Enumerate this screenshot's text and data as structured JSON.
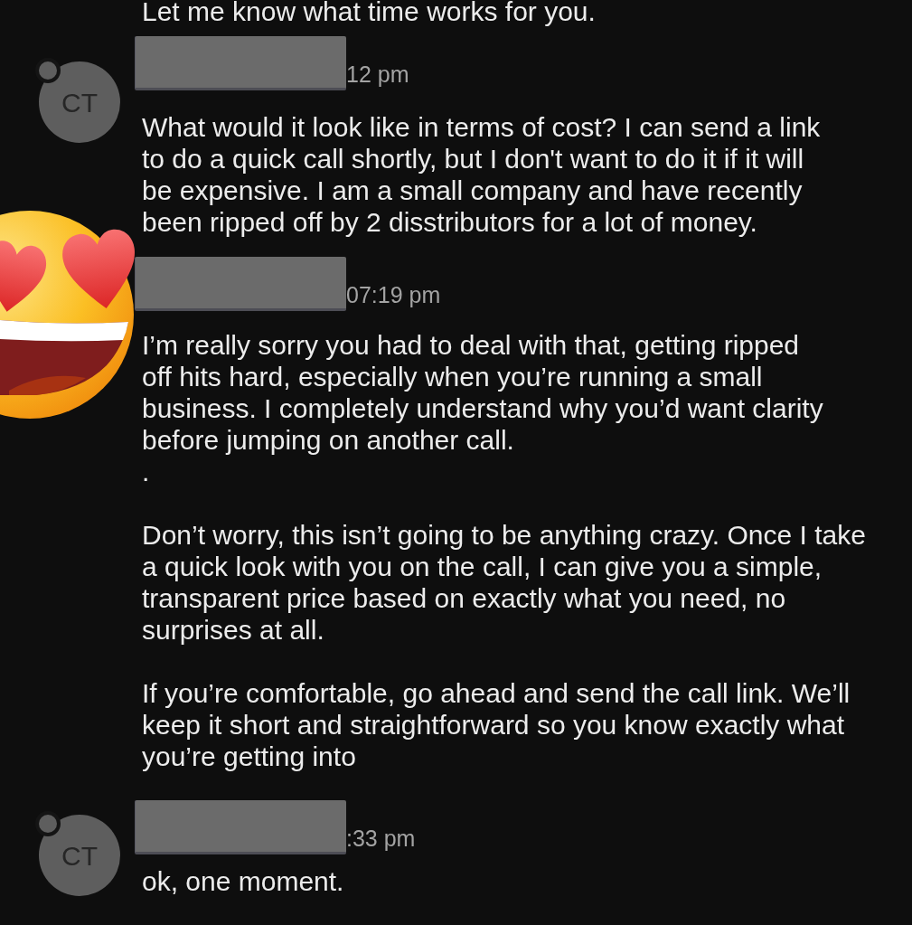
{
  "previous_message": {
    "text": "Let me know what time works for you."
  },
  "messages": [
    {
      "avatar": {
        "initials": "CT"
      },
      "sender_redacted": true,
      "time": "12 pm",
      "text": "What would it look like in terms of cost? I can send a link\nto do a quick call shortly, but I don't want to do it if it will\nbe expensive. I am a small company and have recently\nbeen ripped off by 2 disstributors for a lot of money."
    },
    {
      "sender_redacted": true,
      "time": "07:19 pm",
      "text": "I’m really sorry you had to deal with that, getting ripped\noff hits hard, especially when you’re running a small\nbusiness. I completely understand why you’d want clarity\nbefore jumping on another call.\n.\n\nDon’t worry, this isn’t going to be anything crazy. Once I take\na quick look with you on the call, I can give you a simple,\ntransparent price based on exactly what you need, no\nsurprises at all.\n\nIf you’re comfortable, go ahead and send the call link. We’ll\nkeep it short and straightforward so you know exactly what\nyou’re getting into"
    },
    {
      "avatar": {
        "initials": "CT"
      },
      "sender_redacted": true,
      "time": ":33 pm",
      "text": "ok, one moment."
    }
  ]
}
